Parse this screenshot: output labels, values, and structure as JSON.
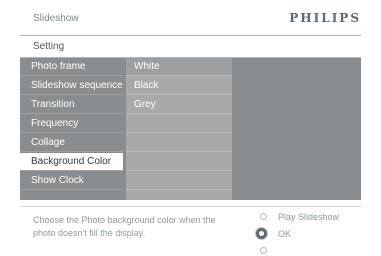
{
  "header": {
    "title": "Slideshow",
    "brand": "PHILIPS"
  },
  "subheader": {
    "title": "Setting"
  },
  "menu": {
    "items": [
      {
        "label": "Photo frame"
      },
      {
        "label": "Slideshow sequence"
      },
      {
        "label": "Transition"
      },
      {
        "label": "Frequency"
      },
      {
        "label": "Collage"
      },
      {
        "label": "Background Color",
        "selected": true
      },
      {
        "label": "Show Clock"
      }
    ]
  },
  "options": {
    "items": [
      "White",
      "Black",
      "Grey"
    ]
  },
  "footer": {
    "help": "Choose the Photo background color when the photo doesn't fill the display.",
    "play_label": "Play Slideshow",
    "ok_label": "OK"
  },
  "colors": {
    "panel": "#8a8d8f",
    "options_column": "#a7a9ab",
    "selected_row": "#ffffff",
    "brand_text": "#5d6a73"
  }
}
